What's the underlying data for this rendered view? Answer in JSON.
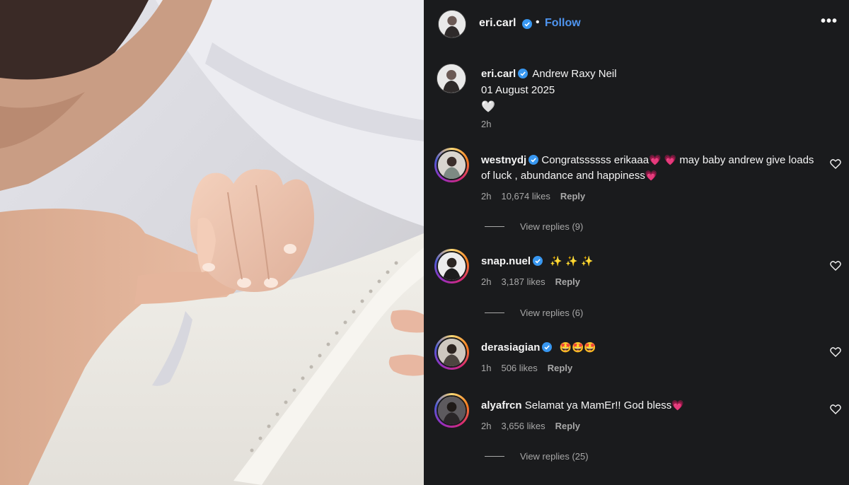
{
  "post": {
    "username": "eri.carl",
    "follow_label": "Follow",
    "more_icon": "more-icon",
    "caption_username": "eri.carl",
    "caption_line1": "Andrew Raxy Neil",
    "caption_line2": "01 August 2025",
    "caption_emoji": "🤍",
    "caption_time": "2h"
  },
  "comments": [
    {
      "username": "westnydj",
      "verified": true,
      "text_part1": "Congratssssss erikaaa",
      "emoji1": "💗",
      "emoji2": "💗",
      "text_part2": "may baby andrew give loads of luck , abundance and happiness",
      "emoji3": "💗",
      "time": "2h",
      "likes": "10,674 likes",
      "reply_label": "Reply",
      "view_replies": "View replies (9)"
    },
    {
      "username": "snap.nuel",
      "verified": true,
      "text": "✨ ✨ ✨",
      "time": "2h",
      "likes": "3,187 likes",
      "reply_label": "Reply",
      "view_replies": "View replies (6)"
    },
    {
      "username": "derasiagian",
      "verified": true,
      "text": "🤩🤩🤩",
      "time": "1h",
      "likes": "506 likes",
      "reply_label": "Reply"
    },
    {
      "username": "alyafrcn",
      "verified": false,
      "text": "Selamat ya MamEr!! God bless",
      "emoji": "💗",
      "time": "2h",
      "likes": "3,656 likes",
      "reply_label": "Reply",
      "view_replies": "View replies (25)"
    }
  ],
  "colors": {
    "panel_bg": "#1a1b1d",
    "link_blue": "#4f95f0",
    "verified_blue": "#3897f0",
    "muted_text": "#a8a8a8",
    "heart_pink": "#ff3b70"
  }
}
